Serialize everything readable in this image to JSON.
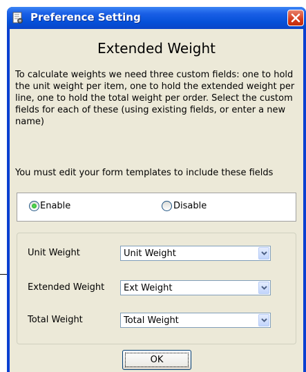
{
  "window": {
    "title": "Preference Setting",
    "icon": "document-settings-icon",
    "close_icon": "close-icon"
  },
  "dialog": {
    "heading": "Extended Weight",
    "description": "To calculate weights we need three custom fields: one to hold the unit weight per item, one to hold the extended weight per line, one to hold the total weight per order. Select the custom fields for each of these (using existing fields, or enter a new name)",
    "note": "You must edit your form templates to include these fields"
  },
  "mode": {
    "enable_label": "Enable",
    "disable_label": "Disable",
    "selected": "Enable"
  },
  "fields": [
    {
      "label": "Unit Weight",
      "value": "Unit Weight"
    },
    {
      "label": "Extended Weight",
      "value": "Ext Weight"
    },
    {
      "label": "Total Weight",
      "value": "Total Weight"
    }
  ],
  "buttons": {
    "ok_label": "OK"
  },
  "colors": {
    "titlebar": "#0550d8",
    "dialog_bg": "#ece9d8",
    "radio_selected": "#21a121",
    "close_button": "#d63b1b"
  }
}
